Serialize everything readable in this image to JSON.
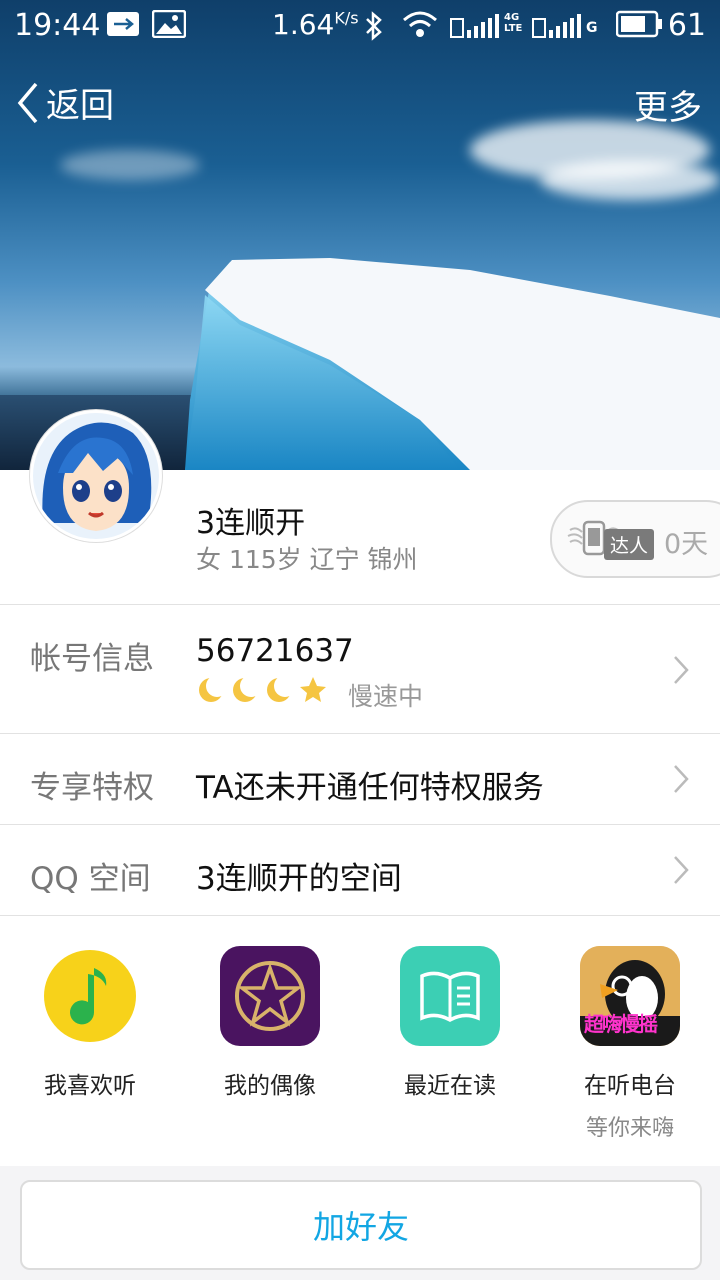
{
  "status_bar": {
    "time": "19:44",
    "speed": "1.64",
    "speed_unit": "K/s",
    "sim1_tag": "4G LTE",
    "sim2_tag": "G",
    "battery": "61"
  },
  "nav": {
    "back_label": "返回",
    "more_label": "更多"
  },
  "profile": {
    "nickname": "3连顺开",
    "info": "女 115岁 辽宁 锦州",
    "badge_tag": "达人",
    "badge_days": "0天"
  },
  "rows": {
    "account": {
      "label": "帐号信息",
      "qq_number": "56721637",
      "status": "慢速中"
    },
    "privilege": {
      "label": "专享特权",
      "value": "TA还未开通任何特权服务"
    },
    "qzone": {
      "label": "QQ 空间",
      "value": "3连顺开的空间"
    }
  },
  "apps": [
    {
      "label": "我喜欢听",
      "sub": "",
      "icon": "qq-music-icon"
    },
    {
      "label": "我的偶像",
      "sub": "",
      "icon": "star-idol-icon"
    },
    {
      "label": "最近在读",
      "sub": "",
      "icon": "book-icon"
    },
    {
      "label": "在听电台",
      "sub": "等你来嗨",
      "icon": "penguin-radio-icon",
      "icon_text": "超嗨慢摇"
    }
  ],
  "bottom": {
    "add_friend": "加好友"
  },
  "colors": {
    "accent": "#12a6e3",
    "music_yellow": "#f7d21a",
    "idol_purple": "#4a1460",
    "book_teal": "#3ccfb4"
  }
}
